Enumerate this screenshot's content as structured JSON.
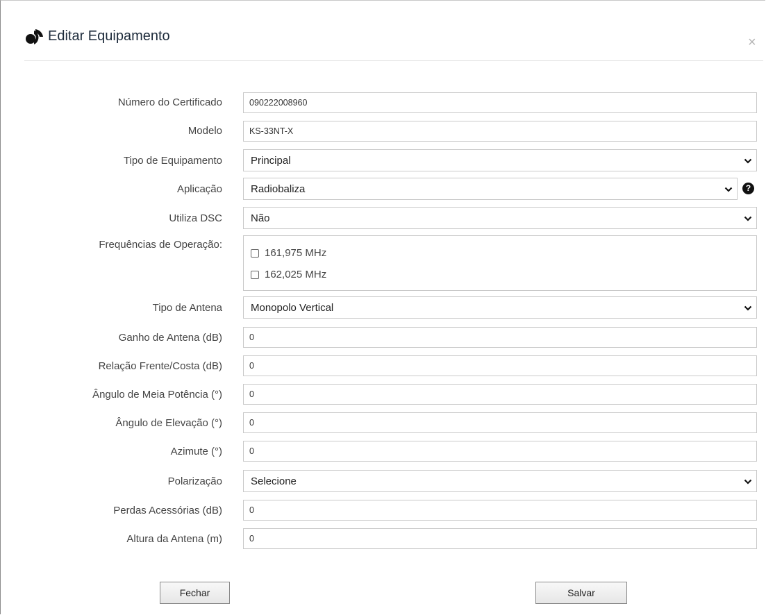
{
  "dialog": {
    "title": "Editar Equipamento",
    "close_glyph": "×"
  },
  "form": {
    "certificado": {
      "label": "Número do Certificado",
      "value": "090222008960"
    },
    "modelo": {
      "label": "Modelo",
      "value": "KS-33NT-X"
    },
    "tipo_equipamento": {
      "label": "Tipo de Equipamento",
      "value": "Principal"
    },
    "aplicacao": {
      "label": "Aplicação",
      "value": "Radiobaliza",
      "help_glyph": "?"
    },
    "utiliza_dsc": {
      "label": "Utiliza DSC",
      "value": "Não"
    },
    "frequencias": {
      "label": "Frequências de Operação:",
      "options": [
        {
          "label": "161,975 MHz",
          "checked": false
        },
        {
          "label": "162,025 MHz",
          "checked": false
        }
      ]
    },
    "tipo_antena": {
      "label": "Tipo de Antena",
      "value": "Monopolo Vertical"
    },
    "ganho_antena": {
      "label": "Ganho de Antena (dB)",
      "value": "0"
    },
    "relacao_frente_costa": {
      "label": "Relação Frente/Costa (dB)",
      "value": "0"
    },
    "angulo_meia_potencia": {
      "label": "Ângulo de Meia Potência (°)",
      "value": "0"
    },
    "angulo_elevacao": {
      "label": "Ângulo de Elevação (°)",
      "value": "0"
    },
    "azimute": {
      "label": "Azimute (°)",
      "value": "0"
    },
    "polarizacao": {
      "label": "Polarização",
      "value": "Selecione"
    },
    "perdas_acessorias": {
      "label": "Perdas Acessórias (dB)",
      "value": "0"
    },
    "altura_antena": {
      "label": "Altura da Antena (m)",
      "value": "0"
    }
  },
  "buttons": {
    "fechar": "Fechar",
    "salvar": "Salvar"
  },
  "icons": {
    "logo": "brand-logo-icon",
    "close": "close-icon",
    "chevron": "chevron-down-icon",
    "help": "help-icon"
  },
  "colors": {
    "title": "#1c2a3a",
    "border": "#c9c9c9",
    "label": "#444444"
  }
}
